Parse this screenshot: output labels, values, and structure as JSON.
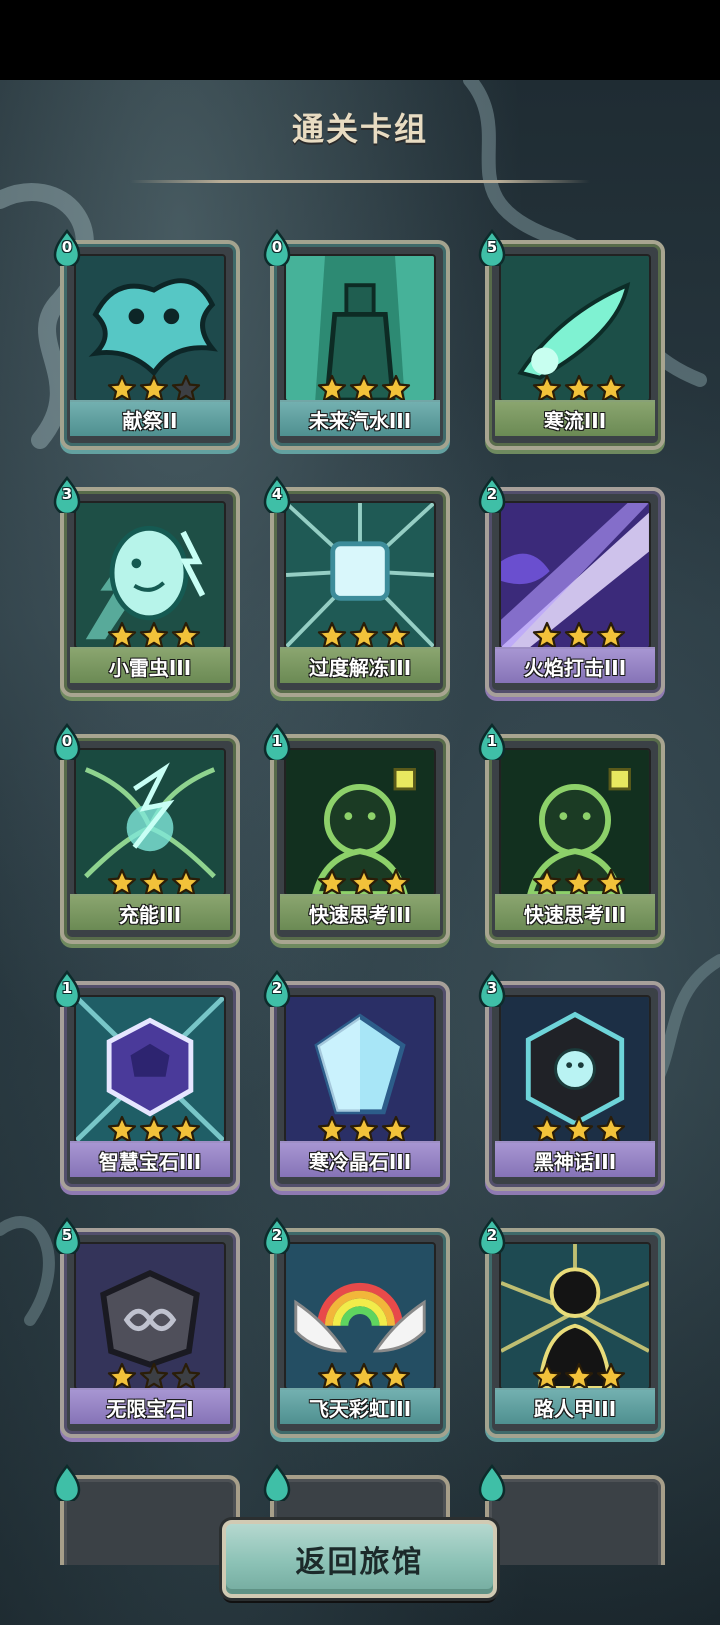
{
  "screen": {
    "title": "通关卡组",
    "return_button_label": "返回旅馆"
  },
  "colors": {
    "star_filled": "#f2c23a",
    "star_empty": "#3c3f44",
    "cost_drop": "#3fbfa7",
    "plate_green": "#7b9862",
    "plate_cyan": "#5fa2a2",
    "plate_purple": "#9483c4"
  },
  "cards": [
    {
      "name": "献祭II",
      "cost": "0",
      "stars": 2,
      "plate": "cyan",
      "icon": "sacrifice-art-icon"
    },
    {
      "name": "未来汽水III",
      "cost": "0",
      "stars": 3,
      "plate": "cyan",
      "icon": "soda-bottle-art-icon"
    },
    {
      "name": "寒流III",
      "cost": "5",
      "stars": 3,
      "plate": "green",
      "icon": "cold-wave-art-icon"
    },
    {
      "name": "小雷虫III",
      "cost": "3",
      "stars": 3,
      "plate": "green",
      "icon": "thunder-bug-art-icon"
    },
    {
      "name": "过度解冻III",
      "cost": "4",
      "stars": 3,
      "plate": "green",
      "icon": "ice-cube-art-icon"
    },
    {
      "name": "火焰打击III",
      "cost": "2",
      "stars": 3,
      "plate": "purple",
      "icon": "flame-strike-art-icon"
    },
    {
      "name": "充能III",
      "cost": "0",
      "stars": 3,
      "plate": "green",
      "icon": "charge-art-icon"
    },
    {
      "name": "快速思考III",
      "cost": "1",
      "stars": 3,
      "plate": "green",
      "icon": "quick-think-art-icon"
    },
    {
      "name": "快速思考III",
      "cost": "1",
      "stars": 3,
      "plate": "green",
      "icon": "quick-think-art-icon"
    },
    {
      "name": "智慧宝石III",
      "cost": "1",
      "stars": 3,
      "plate": "purple",
      "icon": "wisdom-gem-art-icon"
    },
    {
      "name": "寒冷晶石III",
      "cost": "2",
      "stars": 3,
      "plate": "purple",
      "icon": "cold-crystal-art-icon"
    },
    {
      "name": "黑神话III",
      "cost": "3",
      "stars": 3,
      "plate": "purple",
      "icon": "black-myth-art-icon"
    },
    {
      "name": "无限宝石I",
      "cost": "5",
      "stars": 1,
      "plate": "purple",
      "icon": "infinity-gem-art-icon"
    },
    {
      "name": "飞天彩虹III",
      "cost": "2",
      "stars": 3,
      "plate": "cyan",
      "icon": "flying-rainbow-art-icon"
    },
    {
      "name": "路人甲III",
      "cost": "2",
      "stars": 3,
      "plate": "cyan",
      "icon": "passerby-art-icon"
    }
  ]
}
